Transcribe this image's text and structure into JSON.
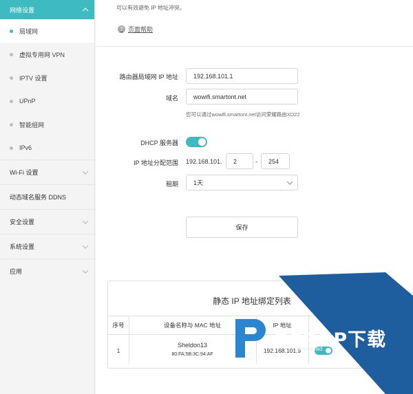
{
  "sidebar": {
    "section_title": "网络设置",
    "items": [
      {
        "label": "局域网",
        "active": true
      },
      {
        "label": "虚拟专用网 VPN",
        "active": false
      },
      {
        "label": "IPTV 设置",
        "active": false
      },
      {
        "label": "UPnP",
        "active": false
      },
      {
        "label": "智能组网",
        "active": false
      },
      {
        "label": "IPv6",
        "active": false
      }
    ],
    "groups": [
      {
        "label": "Wi-Fi 设置",
        "has_chevron": true
      },
      {
        "label": "动态域名服务 DDNS",
        "has_chevron": false
      },
      {
        "label": "安全设置",
        "has_chevron": true
      },
      {
        "label": "系统设置",
        "has_chevron": true
      },
      {
        "label": "应用",
        "has_chevron": true
      }
    ]
  },
  "main": {
    "notice": "可以有效避免 IP 地址冲突。",
    "help_label": "页面帮助",
    "lan_ip_label": "路由器局域网 IP 地址",
    "lan_ip_value": "192.168.101.1",
    "domain_label": "域名",
    "domain_value": "wowifi.smartont.net",
    "domain_hint": "您可以通过wowifi.smartont.net访问荣耀路由XD22",
    "dhcp_label": "DHCP 服务器",
    "dhcp_enabled": true,
    "range_label": "IP 地址分配范围",
    "range_prefix": "192.168.101.",
    "range_start": "2",
    "range_sep": "-",
    "range_end": "254",
    "lease_label": "租期",
    "lease_value": "1天",
    "save_label": "保存"
  },
  "static_table": {
    "title": "静态 IP 地址绑定列表",
    "headers": [
      "序号",
      "设备名称与 MAC 地址",
      "IP 地址"
    ],
    "rows": [
      {
        "index": "1",
        "name": "Sheldon13",
        "mac": "80:FA:5B:3C:94:AF",
        "ip": "192.168.101.9",
        "enabled": true
      }
    ]
  },
  "watermark": {
    "brand": "PCPOP下载",
    "sub": "download"
  },
  "colors": {
    "accent": "#3dbbc0",
    "watermark_blue": "#1f5e9e"
  }
}
